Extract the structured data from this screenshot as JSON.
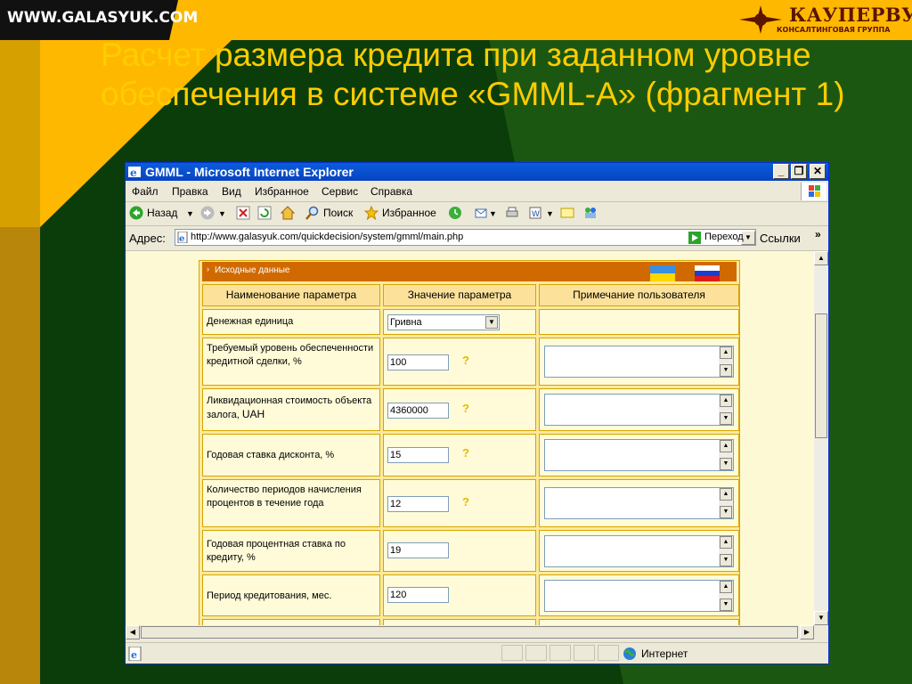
{
  "colors": {
    "title": "#ffcc00",
    "accent_bar": "#ffb800",
    "dark_green": "#0b3d0b",
    "ie_blue": "#0843c1"
  },
  "slide": {
    "site_label": "WWW.GALASYUK.COM",
    "logo_title": "КАУПЕРВУД",
    "logo_subtitle": "КОНСАЛТИНГОВАЯ ГРУППА",
    "title": "Расчет размера кредита при заданном уровне обеспечения в системе «GMML-A» (фрагмент 1)"
  },
  "browser": {
    "window_title": "GMML - Microsoft Internet Explorer",
    "menu": [
      "Файл",
      "Правка",
      "Вид",
      "Избранное",
      "Сервис",
      "Справка"
    ],
    "toolbar": {
      "back": "Назад",
      "search": "Поиск",
      "favorites": "Избранное"
    },
    "address_label": "Адрес:",
    "url": "http://www.galasyuk.com/quickdecision/system/gmml/main.php",
    "go": "Переход",
    "links": "Ссылки",
    "status_zone": "Интернет"
  },
  "form": {
    "section_title": "Исходные данные",
    "columns": [
      "Наименование параметра",
      "Значение параметра",
      "Примечание пользователя"
    ],
    "currency_label": "Денежная единица",
    "currency_value": "Гривна",
    "rows": [
      {
        "label": "Требуемый уровень обеспеченности кредитной сделки, %",
        "value": "100",
        "help": "?"
      },
      {
        "label": "Ликвидационная стоимость объекта залога,",
        "unit": "UAH",
        "value": "4360000",
        "help": "?"
      },
      {
        "label": "Годовая ставка дисконта, %",
        "value": "15",
        "help": "?"
      },
      {
        "label": "Количество периодов начисления процентов в течение года",
        "value": "12",
        "help": "?"
      },
      {
        "label": "Годовая процентная ставка по кредиту, %",
        "value": "19"
      },
      {
        "label": "Период кредитования, мес.",
        "value": "120"
      }
    ]
  }
}
